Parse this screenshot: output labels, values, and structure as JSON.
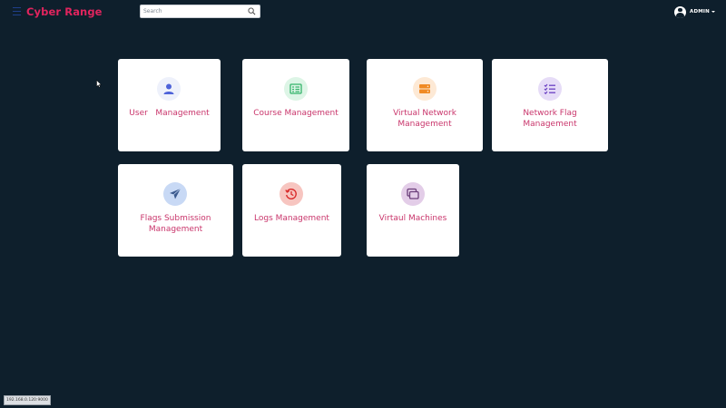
{
  "app": {
    "brand": "Cyber Range"
  },
  "search": {
    "placeholder": "Search",
    "value": ""
  },
  "user": {
    "name": "ADMIN"
  },
  "cards": [
    {
      "label": "User   Management",
      "icon": "user-icon",
      "icon_color": "#4e63d9",
      "icon_bg": "#eef1fb"
    },
    {
      "label": "Course Management",
      "icon": "course-list-icon",
      "icon_color": "#34b36a",
      "icon_bg": "#ddf5e6"
    },
    {
      "label": "Virtual Network\nManagement",
      "icon": "server-icon",
      "icon_color": "#f08a24",
      "icon_bg": "#fde9d5"
    },
    {
      "label": "Network Flag\nManagement",
      "icon": "checklist-icon",
      "icon_color": "#6a3fc2",
      "icon_bg": "#e6dcf7"
    },
    {
      "label": "Flags Submission\nManagement",
      "icon": "paper-plane-icon",
      "icon_color": "#3b5a8f",
      "icon_bg": "#c8d9f5"
    },
    {
      "label": "Logs Management",
      "icon": "history-icon",
      "icon_color": "#d92a2a",
      "icon_bg": "#f7c5c0"
    },
    {
      "label": "Virtaul Machines",
      "icon": "windows-stack-icon",
      "icon_color": "#6b3f7a",
      "icon_bg": "#e3cde8"
    }
  ],
  "status_bar": {
    "url": "192.168.0.120:9000"
  },
  "colors": {
    "background": "#0e1f2c",
    "brand": "#e0245e",
    "card_label": "#c9356b"
  }
}
